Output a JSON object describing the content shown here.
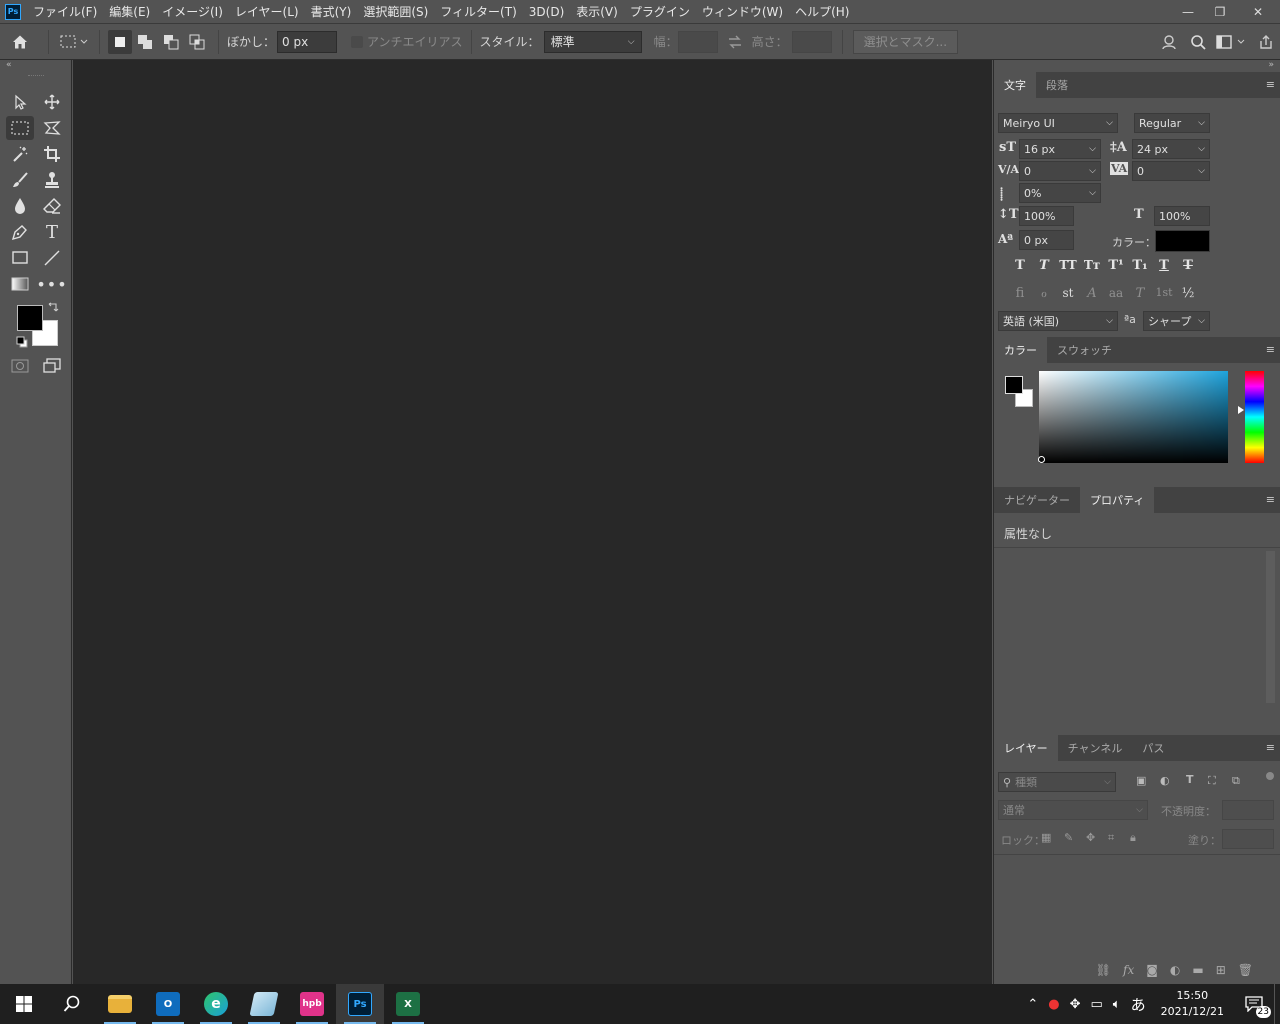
{
  "app": {
    "logo": "Ps"
  },
  "menu": [
    "ファイル(F)",
    "編集(E)",
    "イメージ(I)",
    "レイヤー(L)",
    "書式(Y)",
    "選択範囲(S)",
    "フィルター(T)",
    "3D(D)",
    "表示(V)",
    "プラグイン",
    "ウィンドウ(W)",
    "ヘルプ(H)"
  ],
  "window_controls": {
    "minimize": "—",
    "restore": "❐",
    "close": "✕"
  },
  "options": {
    "feather_label": "ぼかし：",
    "feather_value": "0 px",
    "antialias_label": "アンチエイリアス",
    "style_label": "スタイル：",
    "style_value": "標準",
    "width_label": "幅：",
    "height_label": "高さ：",
    "select_mask": "選択とマスク..."
  },
  "panels": {
    "character": {
      "tabs": [
        "文字",
        "段落"
      ],
      "font_family": "Meiryo UI",
      "font_style": "Regular",
      "font_size": "16 px",
      "leading": "24 px",
      "kerning": "0",
      "tracking": "0",
      "tsume": "0%",
      "vertical_scale": "100%",
      "horizontal_scale": "100%",
      "baseline_shift": "0 px",
      "color_label": "カラー：",
      "text_color": "#000000",
      "language": "英語 (米国)",
      "aa_label": "ªa",
      "antialias": "シャープ",
      "style_glyphs": [
        "T",
        "T",
        "TT",
        "Tт",
        "T¹",
        "T₁",
        "T",
        "T"
      ],
      "opentype_glyphs": [
        "ﬁ",
        "ℴ",
        "st",
        "A",
        "aa",
        "T",
        "1st",
        "½"
      ]
    },
    "color": {
      "tabs": [
        "カラー",
        "スウォッチ"
      ]
    },
    "properties": {
      "tabs": [
        "ナビゲーター",
        "プロパティ"
      ],
      "message": "属性なし"
    },
    "layers": {
      "tabs": [
        "レイヤー",
        "チャンネル",
        "パス"
      ],
      "filter_placeholder": "種類",
      "blend_mode": "通常",
      "opacity_label": "不透明度：",
      "lock_label": "ロック：",
      "fill_label": "塗り："
    }
  },
  "taskbar": {
    "apps": [
      {
        "name": "file-explorer",
        "label": "",
        "color": "#e8b13a"
      },
      {
        "name": "outlook",
        "label": "O",
        "color": "#0f6cbd"
      },
      {
        "name": "edge",
        "label": "e",
        "color": "#1a9fd8"
      },
      {
        "name": "notepad",
        "label": "",
        "color": "#7fb8d8"
      },
      {
        "name": "hpb",
        "label": "hpb",
        "color": "#e0338a"
      },
      {
        "name": "photoshop",
        "label": "Ps",
        "color": "#001e36"
      },
      {
        "name": "excel",
        "label": "X",
        "color": "#1d7044"
      }
    ],
    "time": "15:50",
    "date": "2021/12/21",
    "ime": "あ",
    "notifications": "23"
  }
}
